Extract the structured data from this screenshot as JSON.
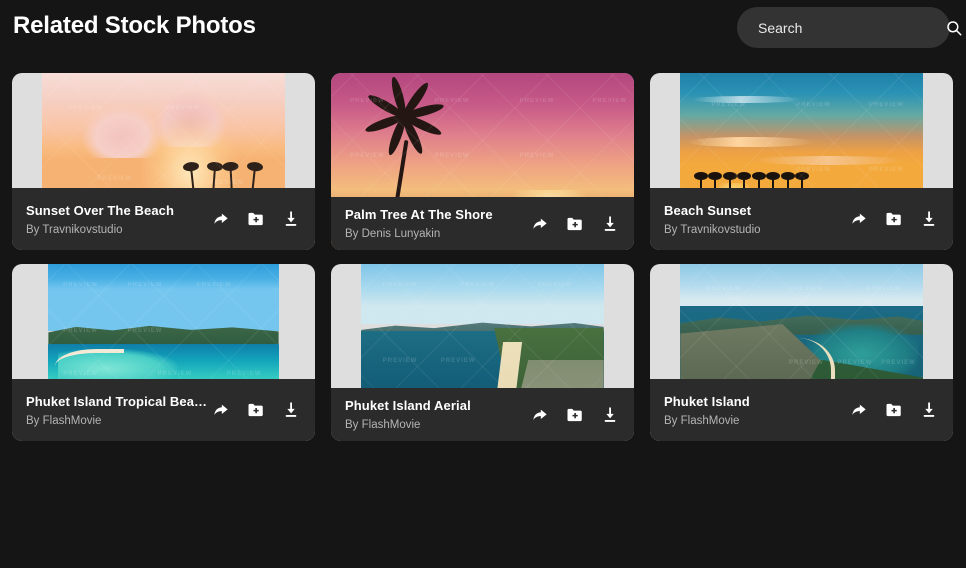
{
  "header": {
    "title": "Related Stock Photos",
    "search": {
      "placeholder": "Search",
      "value": "",
      "icon": "search-icon"
    }
  },
  "theme": {
    "page_background": "#151515",
    "card_background": "#2b2b2b",
    "search_background": "#333333",
    "title_color": "#ffffff",
    "author_color": "#b4b4b4",
    "letterbox_color": "#dedede"
  },
  "actions": {
    "share_label": "share-icon",
    "collection_label": "add-to-collection-icon",
    "download_label": "download-icon"
  },
  "watermark": {
    "text": "PREVIEW"
  },
  "grid": {
    "columns": 3,
    "rows": 2,
    "cards": [
      {
        "title": "Sunset Over The Beach",
        "author": "By Travnikovstudio",
        "art": "img1",
        "fit": "w-wide",
        "caption_height": "cap-tall"
      },
      {
        "title": "Palm Tree At The Shore",
        "author": "By Denis Lunyakin",
        "art": "img2",
        "fit": "w-full",
        "caption_height": "cap-short"
      },
      {
        "title": "Beach Sunset",
        "author": "By Travnikovstudio",
        "art": "img3",
        "fit": "w-wide",
        "caption_height": "cap-tall"
      },
      {
        "title": "Phuket Island Tropical Beach A...",
        "author": "By FlashMovie",
        "art": "img4",
        "fit": "w-narrow",
        "caption_height": "cap-tall"
      },
      {
        "title": "Phuket Island Aerial",
        "author": "By FlashMovie",
        "art": "img5",
        "fit": "w-wide",
        "caption_height": "cap-short"
      },
      {
        "title": "Phuket Island",
        "author": "By FlashMovie",
        "art": "img6",
        "fit": "w-wide",
        "caption_height": "cap-tall"
      }
    ]
  }
}
